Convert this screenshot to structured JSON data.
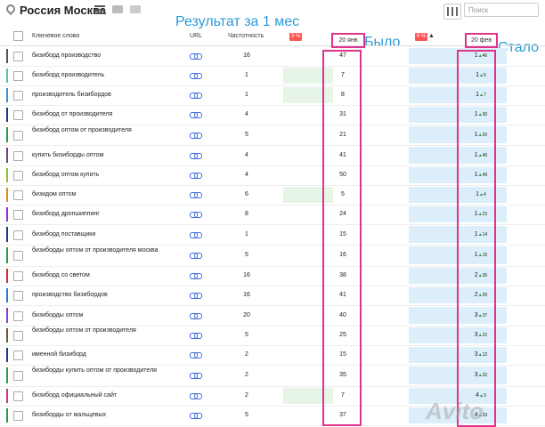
{
  "toolbar": {
    "title": "Россия Москва",
    "search_placeholder": "Поиск"
  },
  "annotations": {
    "result_label": "Результат за 1 мес",
    "before_label": "Было",
    "after_label": "Стало"
  },
  "table": {
    "headers": {
      "keyword": "Ключевое слово",
      "url": "URL",
      "frequency": "Частотность",
      "badge1": "3 %",
      "date1": "20 янв",
      "badge2": "6 %",
      "sort_icon": "▲",
      "date2": "20 фев"
    },
    "rows": [
      {
        "kw": "бизиборд производство",
        "freq": "16",
        "was": "47",
        "now": "1",
        "delta": "46",
        "color": "#555",
        "hl1": "",
        "hl2": "#dbeefa"
      },
      {
        "kw": "бизиборд производитель",
        "freq": "1",
        "was": "7",
        "now": "1",
        "delta": "6",
        "color": "#5abfb0",
        "hl1": "#e6f5e6",
        "hl2": "#dbeefa"
      },
      {
        "kw": "производитель бизибордов",
        "freq": "1",
        "was": "8",
        "now": "1",
        "delta": "7",
        "color": "#3a8fd8",
        "hl1": "#e6f5e6",
        "hl2": "#dbeefa"
      },
      {
        "kw": "бизиборд от производителя",
        "freq": "4",
        "was": "31",
        "now": "1",
        "delta": "30",
        "color": "#1a3a8f",
        "hl1": "",
        "hl2": "#dbeefa"
      },
      {
        "kw": "бизиборд оптом от производителя",
        "freq": "5",
        "was": "21",
        "now": "1",
        "delta": "20",
        "color": "#2a9d3a",
        "hl1": "",
        "hl2": "#dbeefa"
      },
      {
        "kw": "купить бизиборды оптом",
        "freq": "4",
        "was": "41",
        "now": "1",
        "delta": "40",
        "color": "#7a3a8f",
        "hl1": "",
        "hl2": "#dbeefa"
      },
      {
        "kw": "бизиборд оптом купить",
        "freq": "4",
        "was": "50",
        "now": "1",
        "delta": "49",
        "color": "#8fbf3a",
        "hl1": "",
        "hl2": "#dbeefa"
      },
      {
        "kw": "бизидом оптом",
        "freq": "6",
        "was": "5",
        "now": "1",
        "delta": "4",
        "color": "#e08a1a",
        "hl1": "#e6f5e6",
        "hl2": "#dbeefa"
      },
      {
        "kw": "бизиборд дропшиппинг",
        "freq": "8",
        "was": "24",
        "now": "1",
        "delta": "23",
        "color": "#9b2ad8",
        "hl1": "",
        "hl2": "#dbeefa"
      },
      {
        "kw": "бизиборд поставщики",
        "freq": "1",
        "was": "15",
        "now": "1",
        "delta": "14",
        "color": "#1a3a8f",
        "hl1": "",
        "hl2": "#dbeefa"
      },
      {
        "kw": "бизиборды оптом от производителя москва",
        "freq": "5",
        "was": "16",
        "now": "1",
        "delta": "15",
        "color": "#2a9d3a",
        "hl1": "",
        "hl2": "#dbeefa"
      },
      {
        "kw": "бизиборд со светом",
        "freq": "16",
        "was": "38",
        "now": "2",
        "delta": "36",
        "color": "#d82a2a",
        "hl1": "",
        "hl2": "#dbeefa"
      },
      {
        "kw": "производство бизибордов",
        "freq": "16",
        "was": "41",
        "now": "2",
        "delta": "39",
        "color": "#2a7ad8",
        "hl1": "",
        "hl2": "#dbeefa"
      },
      {
        "kw": "бизиборды оптом",
        "freq": "20",
        "was": "40",
        "now": "3",
        "delta": "37",
        "color": "#8f3ad8",
        "hl1": "",
        "hl2": "#dbeefa"
      },
      {
        "kw": "бизиборды оптом от производителя",
        "freq": "5",
        "was": "25",
        "now": "3",
        "delta": "22",
        "color": "#6a5a2a",
        "hl1": "",
        "hl2": "#dbeefa"
      },
      {
        "kw": "именной бизиборд",
        "freq": "2",
        "was": "15",
        "now": "3",
        "delta": "12",
        "color": "#1a3a8f",
        "hl1": "",
        "hl2": "#dbeefa"
      },
      {
        "kw": "бизиборды купить оптом от производителя",
        "freq": "2",
        "was": "35",
        "now": "3",
        "delta": "32",
        "color": "#2a9d3a",
        "hl1": "",
        "hl2": "#dbeefa"
      },
      {
        "kw": "бизиборд официальный сайт",
        "freq": "2",
        "was": "7",
        "now": "4",
        "delta": "3",
        "color": "#d82a8f",
        "hl1": "#e6f5e6",
        "hl2": "#dbeefa"
      },
      {
        "kw": "бизиборды от мальцевых",
        "freq": "5",
        "was": "37",
        "now": "4",
        "delta": "33",
        "color": "#2a9d3a",
        "hl1": "",
        "hl2": "#dbeefa"
      }
    ]
  },
  "watermark": "Avito"
}
